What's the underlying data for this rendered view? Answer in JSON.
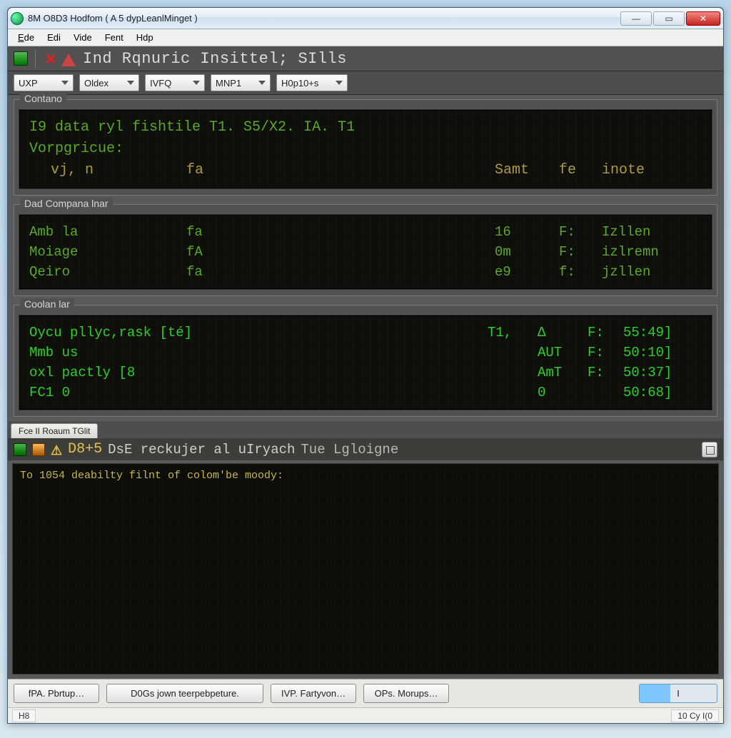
{
  "window": {
    "title": "8M O8D3 Hodfom ( A 5 dypLeanlMinget )"
  },
  "menu": {
    "ede": "Ede",
    "edi": "Edi",
    "vide": "Vide",
    "fent": "Fent",
    "hdp": "Hdp"
  },
  "toolbar": {
    "title": "Ind Rqnuric Insittel; SIlls"
  },
  "combos": {
    "uxp": "UXP",
    "oldx": "Oldex",
    "ivfq": "IVFQ",
    "mnp1": "MNP1",
    "hop10s": "H0p10+s"
  },
  "group_top": {
    "legend": "Contano",
    "line1": "I9 data ryl fishtile  T1. S5/X2. IA. T1",
    "line2": "Vorpgricue:",
    "hdr": {
      "c1": "vj, n",
      "c2": "fa",
      "c3": "Samt",
      "c4": "fe",
      "c5": "inote"
    }
  },
  "group_mid": {
    "legend": "Dad Compana lnar",
    "rows": [
      {
        "c1": "Amb la",
        "c2": "fa",
        "c3": "16",
        "c4": "F:",
        "c5": "Izllen"
      },
      {
        "c1": "Moiage",
        "c2": "fA",
        "c3": "0m",
        "c4": "F:",
        "c5": "izlremn"
      },
      {
        "c1": "Qeiro",
        "c2": "fa",
        "c3": "e9",
        "c4": "f:",
        "c5": "jzllen"
      }
    ]
  },
  "group_bot": {
    "legend": "Coolan lar",
    "rows": [
      {
        "c1": "Oycu pllyc,rask [té]",
        "c2": "",
        "c3": "T1,",
        "c4": "Δ",
        "cf": "F:",
        "c5": "55:49]"
      },
      {
        "c1": "Mmb us",
        "c2": "",
        "c3": "",
        "c4": "AUT",
        "cf": "F:",
        "c5": "50:10]"
      },
      {
        "c1": "oxl pactly [8",
        "c2": "",
        "c3": "",
        "c4": "AmT",
        "cf": "F:",
        "c5": "50:37]"
      },
      {
        "c1": "FC1 0",
        "c2": "",
        "c3": "",
        "c4": "0",
        "cf": "",
        "c5": "50:68]"
      }
    ]
  },
  "tabs": {
    "tab1": "Fce II Roaum TGlit"
  },
  "logtoolbar": {
    "time": "D8+5",
    "text1": "DsE reckujer al uIryach",
    "text2": "Tue Lgloigne"
  },
  "log": {
    "line1": "To 1054 deabilty filnt of colom'be moody:"
  },
  "bottom": {
    "b1": "fPA. Pbrtup…",
    "b2": "D0Gs jown teerpebpeture.",
    "b3": "IVP. Fartyvon…",
    "b4": "OPs. Morups…",
    "prog": "I"
  },
  "status": {
    "left": "H8",
    "right": "10 Cy I(0"
  }
}
